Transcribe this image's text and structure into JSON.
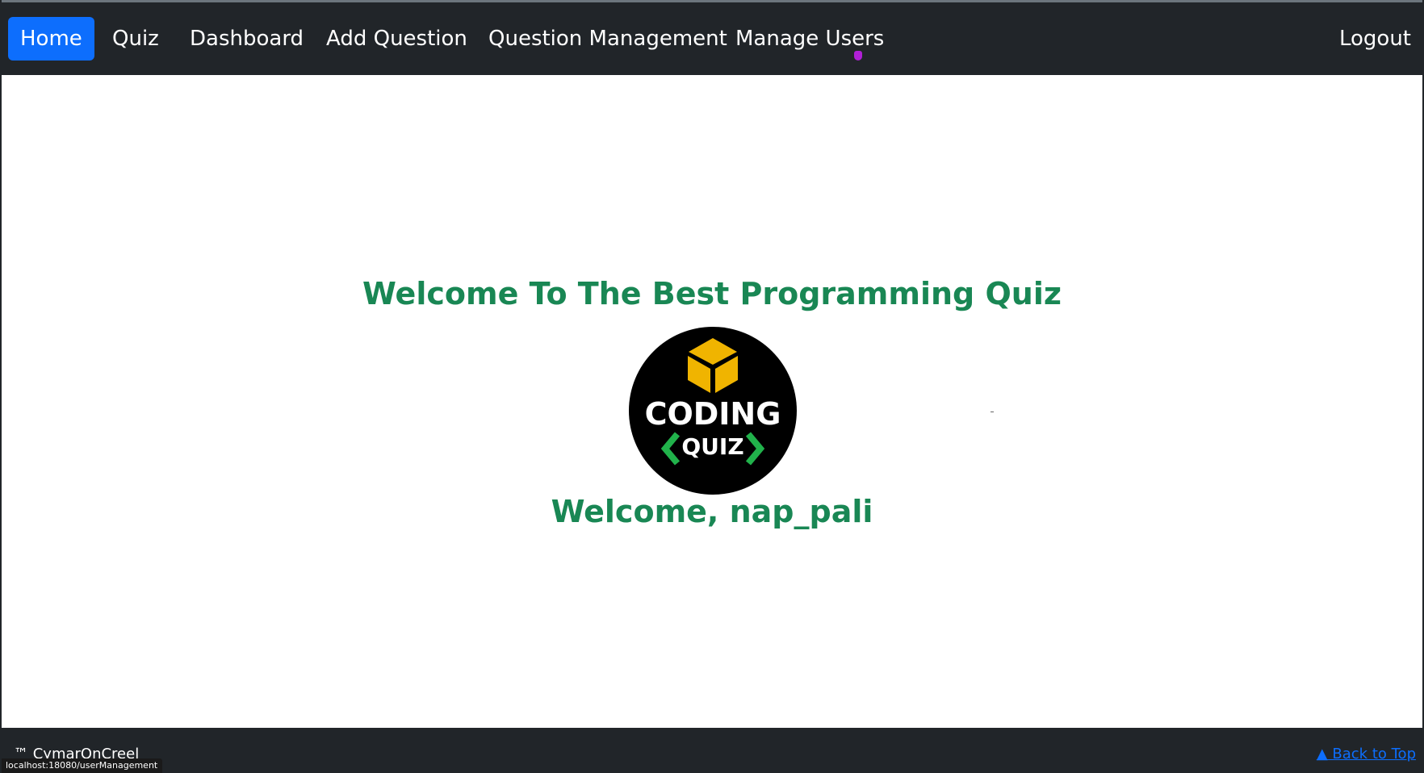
{
  "nav": {
    "home": "Home",
    "quiz": "Quiz",
    "dashboard": "Dashboard",
    "add_question": "Add Question",
    "question_management": "Question Management",
    "manage_users": "Manage Users",
    "logout": "Logout"
  },
  "main": {
    "headline": "Welcome To The Best Programming Quiz",
    "logo": {
      "line1": "CODING",
      "line2": "QUIZ"
    },
    "welcome_user": "Welcome, nap_pali"
  },
  "footer": {
    "brand": "™ CymarOnCreel",
    "back_to_top": "▲ Back to Top"
  },
  "status_bar": {
    "url": "localhost:18080/userManagement"
  },
  "colors": {
    "navbar_bg": "#212529",
    "active_tab": "#0d6efd",
    "heading_green": "#198754",
    "logo_cube": "#f0b400",
    "logo_brackets": "#21b24b",
    "link_blue": "#0d6efd"
  },
  "icons": [
    "cube-icon",
    "cursor-icon",
    "caret-up-icon"
  ]
}
